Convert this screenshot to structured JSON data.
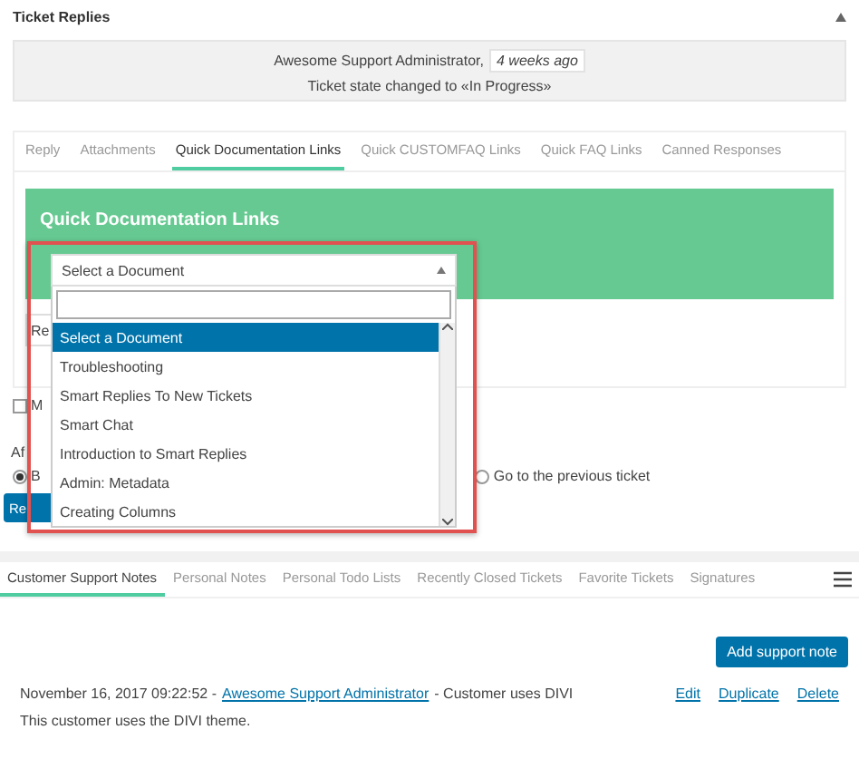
{
  "section": {
    "title": "Ticket Replies"
  },
  "history": {
    "author": "Awesome Support Administrator,",
    "time": "4 weeks ago",
    "message": "Ticket state changed to «In Progress»"
  },
  "reply_tabs": [
    {
      "label": "Reply",
      "selected": false
    },
    {
      "label": "Attachments",
      "selected": false
    },
    {
      "label": "Quick Documentation Links",
      "selected": true
    },
    {
      "label": "Quick CUSTOMFAQ Links",
      "selected": false
    },
    {
      "label": "Quick FAQ Links",
      "selected": false
    },
    {
      "label": "Canned Responses",
      "selected": false
    }
  ],
  "doc_panel": {
    "title": "Quick Documentation Links"
  },
  "hidden_field": {
    "value": "Re"
  },
  "checkbox": {
    "label": "M",
    "checked": false
  },
  "after_label": "Af",
  "radios": [
    {
      "label": "B",
      "selected": true
    },
    {
      "label": "Go to the previous ticket",
      "selected": false
    }
  ],
  "submit_button": "Re",
  "dropdown": {
    "value": "Select a Document",
    "options": [
      {
        "label": "Select a Document",
        "selected": true
      },
      {
        "label": "Troubleshooting",
        "selected": false
      },
      {
        "label": "Smart Replies To New Tickets",
        "selected": false
      },
      {
        "label": "Smart Chat",
        "selected": false
      },
      {
        "label": "Introduction to Smart Replies",
        "selected": false
      },
      {
        "label": "Admin: Metadata",
        "selected": false
      },
      {
        "label": "Creating Columns",
        "selected": false
      }
    ]
  },
  "notes_tabs": [
    {
      "label": "Customer Support Notes",
      "selected": true
    },
    {
      "label": "Personal Notes",
      "selected": false
    },
    {
      "label": "Personal Todo Lists",
      "selected": false
    },
    {
      "label": "Recently Closed Tickets",
      "selected": false
    },
    {
      "label": "Favorite Tickets",
      "selected": false
    },
    {
      "label": "Signatures",
      "selected": false
    }
  ],
  "add_note_button": "Add support note",
  "note": {
    "date": "November 16, 2017 09:22:52 -",
    "author": "Awesome Support Administrator",
    "title": "- Customer uses DIVI",
    "actions": [
      "Edit",
      "Duplicate",
      "Delete"
    ],
    "body": "This customer uses the DIVI theme."
  }
}
